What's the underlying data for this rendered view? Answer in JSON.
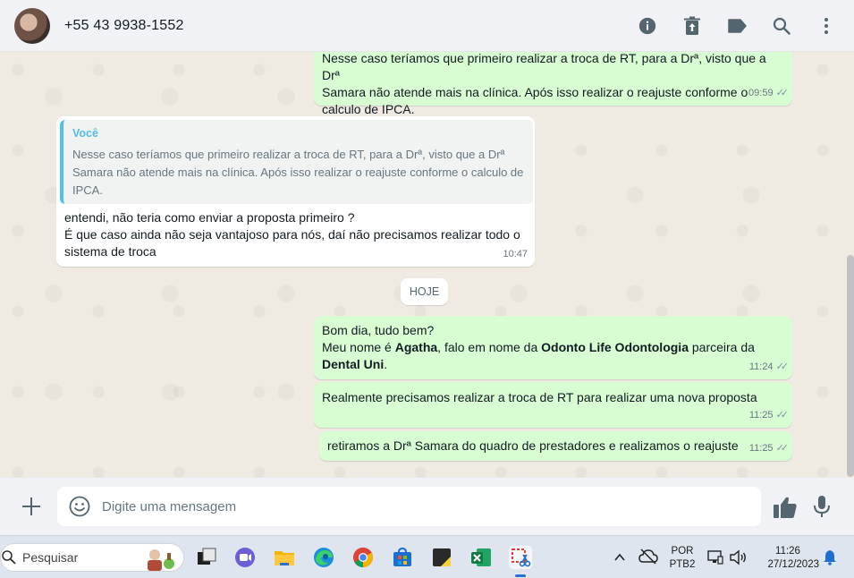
{
  "header": {
    "contact_name": "+55 43 9938-1552",
    "icons": [
      "info-icon",
      "delete-icon",
      "label-icon",
      "search-icon",
      "menu-icon"
    ]
  },
  "messages": [
    {
      "direction": "outgoing",
      "text": "Nesse caso teríamos que primeiro realizar a troca de RT, para a Drª, visto que a Drª\nSamara não atende mais na clínica. Após isso realizar o reajuste conforme o\ncalculo de IPCA.",
      "time": "09:59",
      "read": true
    },
    {
      "direction": "incoming",
      "quoted_author": "Você",
      "quoted_text": "Nesse caso teríamos que primeiro realizar a troca de RT, para a Drª, visto que a Drª\nSamara não atende mais na clínica. Após isso realizar o reajuste conforme o calculo de\nIPCA.",
      "text": "entendi, não teria como enviar a proposta primeiro ?\nÉ que caso ainda não seja vantajoso para nós, daí não precisamos realizar todo o\nsistema de troca",
      "time": "10:47"
    },
    {
      "direction": "outgoing",
      "line1": "Bom dia, tudo bem?",
      "line2_a": "Meu nome é ",
      "line2_b": "Agatha",
      "line2_c": ", falo em nome da ",
      "line2_d": "Odonto Life Odontologia",
      "line2_e": " parceira da",
      "line3": "Dental Uni",
      "line3_end": ".",
      "time": "11:24",
      "read": true
    },
    {
      "direction": "outgoing",
      "text": "Realmente precisamos realizar a troca de RT para realizar uma nova proposta",
      "time": "11:25",
      "read": true
    },
    {
      "direction": "outgoing",
      "text": "retiramos a Drª Samara do quadro de prestadores e realizamos o reajuste",
      "time": "11:25",
      "read": true
    }
  ],
  "day_divider": "HOJE",
  "composer": {
    "placeholder": "Digite uma mensagem",
    "icons": [
      "plus-icon",
      "emoji-icon",
      "thumbs-up-icon",
      "microphone-icon"
    ]
  },
  "taskbar": {
    "search_placeholder": "Pesquisar",
    "apps": [
      "task-view",
      "teams-chat",
      "file-explorer",
      "edge",
      "chrome",
      "microsoft-store",
      "sticky-notes",
      "excel",
      "snipping-tool"
    ],
    "language_line1": "POR",
    "language_line2": "PTB2",
    "time": "11:26",
    "date": "27/12/2023"
  },
  "colors": {
    "outgoing_bubble": "#d9fdd3",
    "incoming_bubble": "#ffffff",
    "chat_background": "#efeae2",
    "quote_accent": "#53bdeb"
  }
}
